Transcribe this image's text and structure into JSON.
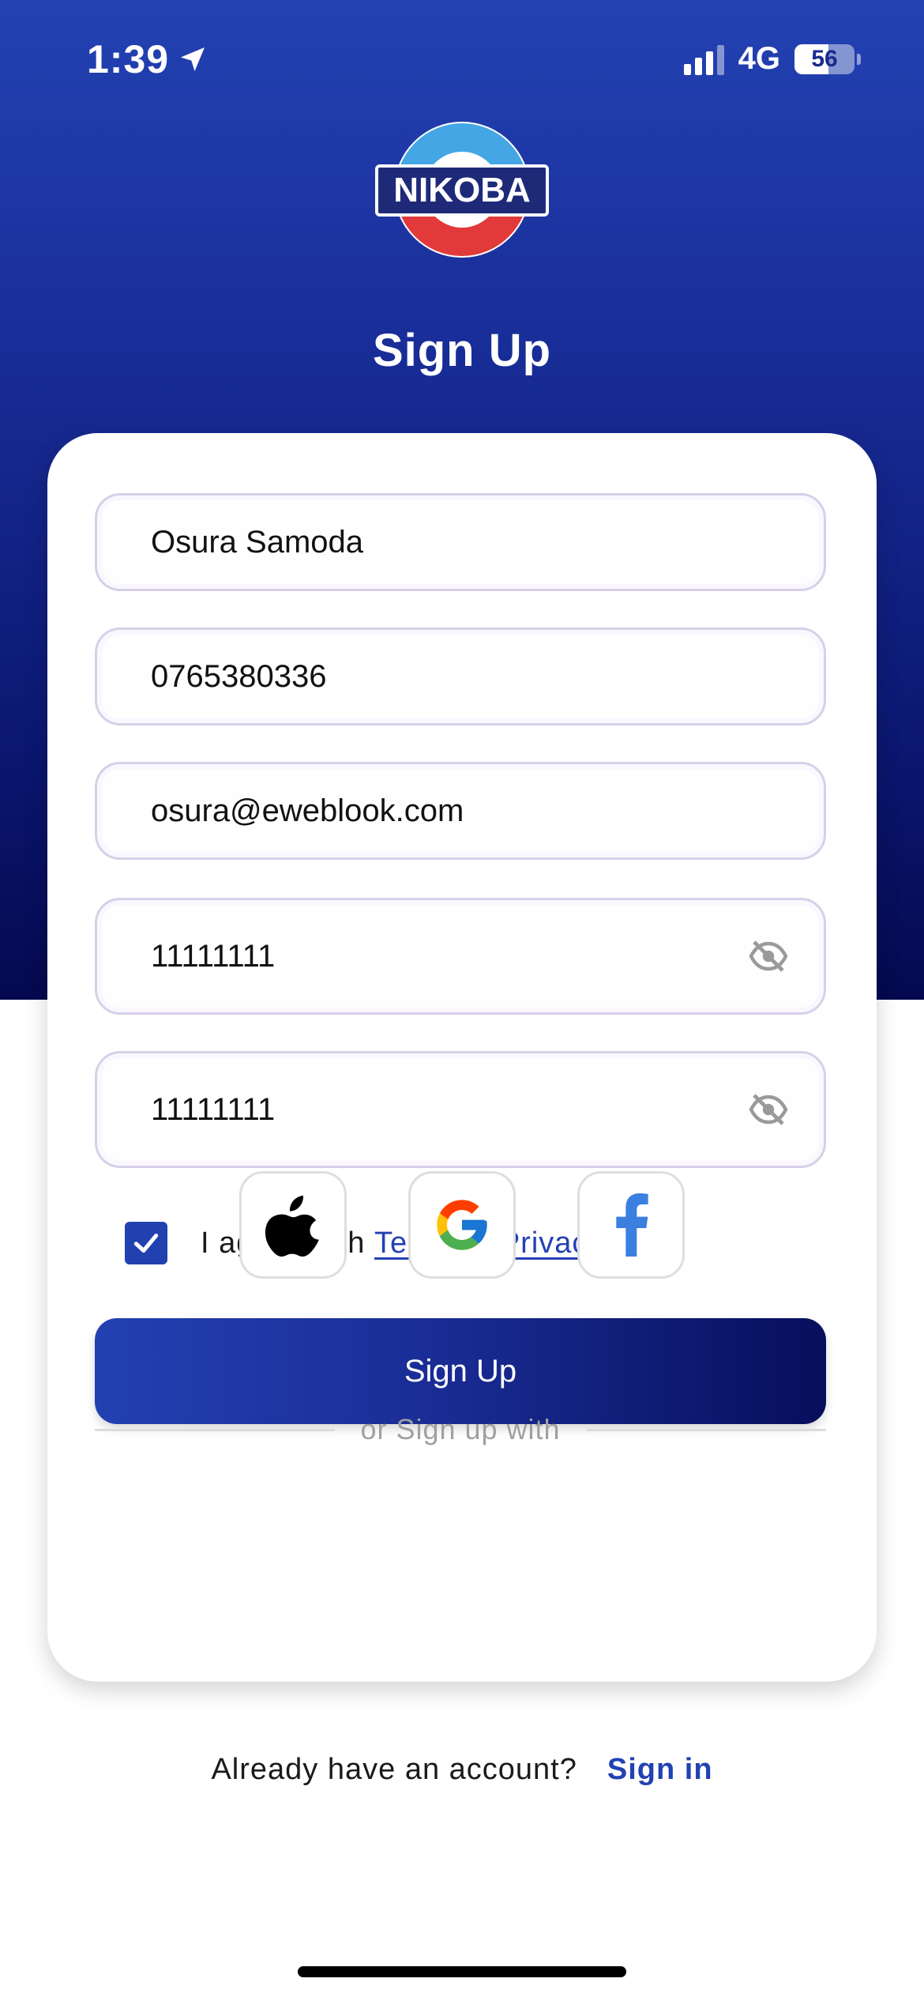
{
  "status_bar": {
    "time": "1:39",
    "network": "4G",
    "battery_level": "56",
    "battery_fraction": 0.56
  },
  "header": {
    "logo_text": "NIKOBA",
    "title": "Sign Up"
  },
  "form": {
    "full_name": "Osura Samoda",
    "phone": "0765380336",
    "email": "osura@eweblook.com",
    "password": "11111111",
    "confirm_password": "11111111",
    "agree_checked": true,
    "agree_prefix": "I agree with",
    "terms_label": "Terms",
    "amp": "&",
    "privacy_label": "Privacy",
    "submit_label": "Sign Up"
  },
  "social": {
    "divider_text": "or Sign up with",
    "providers": [
      "apple-icon",
      "google-icon",
      "facebook-icon"
    ]
  },
  "footer": {
    "question": "Already have an account?",
    "signin_label": "Sign in"
  },
  "colors": {
    "brand_blue": "#2242b3",
    "brand_navy": "#05094f",
    "checkbox": "#2141b0"
  }
}
